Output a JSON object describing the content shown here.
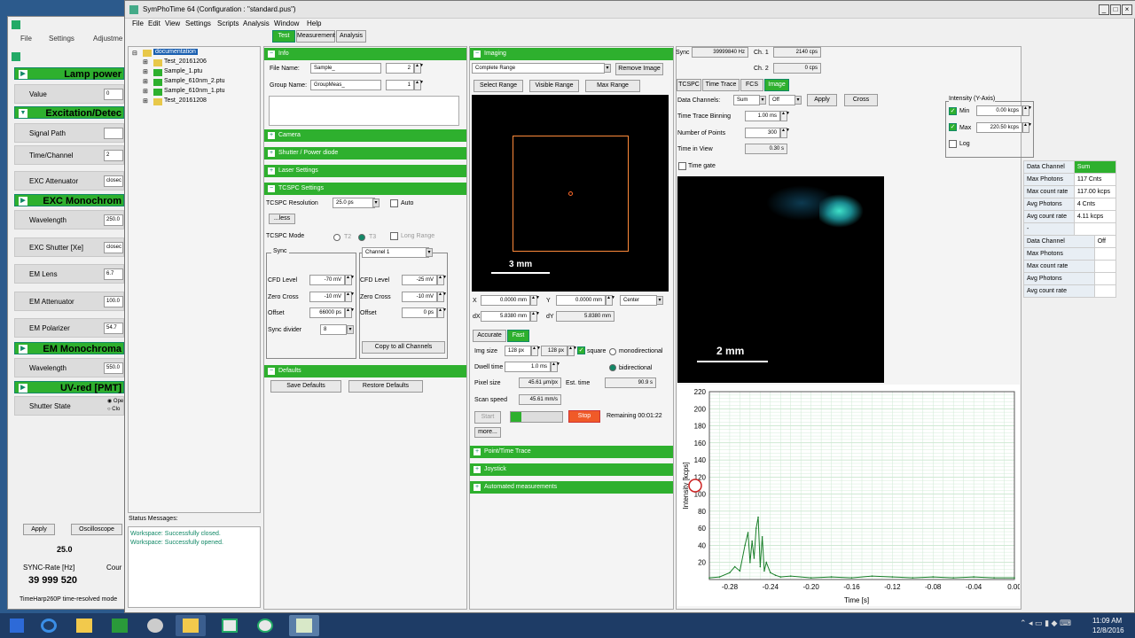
{
  "left_app": {
    "menu": [
      "File",
      "Settings",
      "Adjustme"
    ],
    "sections": [
      {
        "title": "Lamp power",
        "rows": [
          {
            "label": "Value",
            "value": "0"
          }
        ]
      },
      {
        "title": "Excitation/Detec",
        "rows": [
          {
            "label": "Signal Path",
            "value": ""
          },
          {
            "label": "Time/Channel",
            "value": "2"
          },
          {
            "label": "EXC Attenuator",
            "value": "closec"
          }
        ]
      },
      {
        "title": "EXC Monochrom",
        "rows": [
          {
            "label": "Wavelength",
            "value": "250.0"
          },
          {
            "label": "EXC Shutter [Xe]",
            "value": "closec"
          },
          {
            "label": "EM Lens",
            "value": "6.7"
          },
          {
            "label": "EM Attenuator",
            "value": "100.0"
          },
          {
            "label": "EM Polarizer",
            "value": "54.7"
          }
        ]
      },
      {
        "title": "EM Monochroma",
        "rows": [
          {
            "label": "Wavelength",
            "value": "550.0"
          }
        ]
      },
      {
        "title": "UV-red [PMT]",
        "rows": [
          {
            "label": "Shutter State",
            "value": ""
          }
        ]
      }
    ],
    "shutter_opts": [
      "Ope",
      "Clo"
    ],
    "apply": "Apply",
    "oscilloscope": "Oscilloscope",
    "num": "25.0",
    "sync_label": "SYNC-Rate  [Hz]",
    "cour": "Cour",
    "sync_value": "39 999 520",
    "footer": "TimeHarp260P time-resolved mode"
  },
  "main": {
    "title": "SymPhoTime 64  (Configuration : \"standard.pus\")",
    "menu": [
      "File",
      "Edit",
      "View",
      "Settings",
      "Scripts",
      "Analysis",
      "Window",
      "Help"
    ],
    "tabs": [
      "Test",
      "Measurement",
      "Analysis"
    ],
    "tree": [
      "documentation",
      "Test_20161206",
      "Sample_1.ptu",
      "Sample_610nm_2.ptu",
      "Sample_610nm_1.ptu",
      "Test_20161208"
    ],
    "status_title": "Status Messages:",
    "status": [
      "Workspace: Successfully closed.",
      "Workspace: Successfully opened."
    ]
  },
  "info": {
    "head": "Info",
    "file_name_lbl": "File Name:",
    "file_name": "Sample_",
    "file_num": "2",
    "group_lbl": "Group Name:",
    "group": "GroupMeas_",
    "group_num": "1"
  },
  "groups": {
    "camera": "Camera",
    "shutter": "Shutter / Power diode",
    "laser": "Laser Settings",
    "tcspc": "TCSPC Settings",
    "defaults": "Defaults"
  },
  "tcspc": {
    "res_lbl": "TCSPC Resolution",
    "res": "25.0 ps",
    "auto": "Auto",
    "less": "...less",
    "mode_lbl": "TCSPC Mode",
    "t2": "T2",
    "t3": "T3",
    "long": "Long Range",
    "sync": "Sync",
    "channel": "Channel 1",
    "cfd_lbl": "CFD Level",
    "cfd1": "-70 mV",
    "cfd2": "-25 mV",
    "zc_lbl": "Zero Cross",
    "zc1": "-10 mV",
    "zc2": "-10 mV",
    "off_lbl": "Offset",
    "off1": "66000 ps",
    "off2": "0 ps",
    "div_lbl": "Sync divider",
    "div": "8",
    "copy": "Copy to all Channels"
  },
  "defaults": {
    "save": "Save Defaults",
    "restore": "Restore Defaults"
  },
  "imaging": {
    "head": "Imaging",
    "range": "Complete Range",
    "remove": "Remove Image",
    "select": "Select Range",
    "visible": "Visible Range",
    "max": "Max Range",
    "scale": "3 mm",
    "x_lbl": "X",
    "x": "0.0000 mm",
    "y_lbl": "Y",
    "y": "0.0000 mm",
    "center": "Center",
    "dx_lbl": "dX",
    "dx": "5.8380 mm",
    "dy_lbl": "dY",
    "dy": "5.8380 mm",
    "accurate": "Accurate",
    "fast": "Fast",
    "img_size_lbl": "Img size",
    "img_w": "128 px",
    "img_h": "128 px",
    "square": "square",
    "mono": "monodirectional",
    "bi": "bidirectional",
    "dwell_lbl": "Dwell time",
    "dwell": "1.0 ms",
    "px_lbl": "Pixel size",
    "px": "45.61 µm/px",
    "est_lbl": "Est. time",
    "est": "90.9 s",
    "scan_lbl": "Scan speed",
    "scan": "45.61 mm/s",
    "start": "Start",
    "stop": "Stop",
    "remaining": "Remaining  00:01:22",
    "more": "more...",
    "point": "Point/Time Trace",
    "joystick": "Joystick",
    "auto_meas": "Automated measurements"
  },
  "right": {
    "sync_lbl": "Sync",
    "sync": "39999840 Hz",
    "ch1_lbl": "Ch. 1",
    "ch1": "2140 cps",
    "ch2_lbl": "Ch. 2",
    "ch2": "0 cps",
    "tabs": [
      "TCSPC",
      "Time Trace",
      "FCS",
      "Image"
    ],
    "dc_lbl": "Data Channels:",
    "dc1": "Sum",
    "dc2": "Off",
    "apply": "Apply",
    "cross": "Cross",
    "ttb_lbl": "Time Trace Binning",
    "ttb": "1.00 ms",
    "nop_lbl": "Number of Points",
    "nop": "300",
    "tiv_lbl": "Time in View",
    "tiv": "0.30 s",
    "timegate": "Time gate",
    "intensity": "Intensity (Y-Axis)",
    "min_lbl": "Min",
    "min": "0.00 kcps",
    "max_lbl": "Max",
    "max": "220.50 kcps",
    "log": "Log",
    "scale": "2 mm",
    "stats1": [
      [
        "Data Channel",
        "Sum"
      ],
      [
        "Max Photons",
        "117 Cnts"
      ],
      [
        "Max count rate",
        "117.00 kcps"
      ],
      [
        "Avg Photons",
        "4 Cnts"
      ],
      [
        "Avg count rate",
        "4.11 kcps"
      ],
      [
        "-",
        ""
      ]
    ],
    "stats2": [
      [
        "Data Channel",
        "Off"
      ],
      [
        "Max Photons",
        ""
      ],
      [
        "Max count rate",
        ""
      ],
      [
        "Avg Photons",
        ""
      ],
      [
        "Avg count rate",
        ""
      ]
    ]
  },
  "chart_data": {
    "type": "line",
    "xlabel": "Time [s]",
    "ylabel": "Intensity [kcps]",
    "xlim": [
      -0.3,
      0.0
    ],
    "ylim": [
      0,
      220
    ],
    "xticks": [
      "-0.28",
      "-0.24",
      "-0.20",
      "-0.16",
      "-0.12",
      "-0.08",
      "-0.04",
      "0.00"
    ],
    "yticks": [
      "20",
      "40",
      "60",
      "80",
      "100",
      "120",
      "140",
      "160",
      "180",
      "200",
      "220"
    ],
    "series": [
      {
        "x": [
          -0.3,
          -0.29,
          -0.28,
          -0.275,
          -0.27,
          -0.265,
          -0.262,
          -0.26,
          -0.258,
          -0.256,
          -0.254,
          -0.252,
          -0.25,
          -0.248,
          -0.246,
          -0.244,
          -0.24,
          -0.235,
          -0.23,
          -0.22,
          -0.2,
          -0.18,
          -0.16,
          -0.14,
          -0.12,
          -0.1,
          -0.08,
          -0.06,
          -0.04,
          -0.02,
          0.0
        ],
        "y": [
          2,
          3,
          8,
          15,
          10,
          40,
          55,
          20,
          45,
          25,
          60,
          73,
          15,
          50,
          10,
          20,
          8,
          5,
          3,
          4,
          2,
          3,
          2,
          4,
          3,
          2,
          3,
          2,
          3,
          2,
          2
        ]
      }
    ]
  },
  "taskbar": {
    "time": "11:09 AM",
    "date": "12/8/2016"
  },
  "colors": {
    "accent": "#2eb02e",
    "taskbar": "#1e3c66",
    "plot": "#1a7f2a"
  }
}
